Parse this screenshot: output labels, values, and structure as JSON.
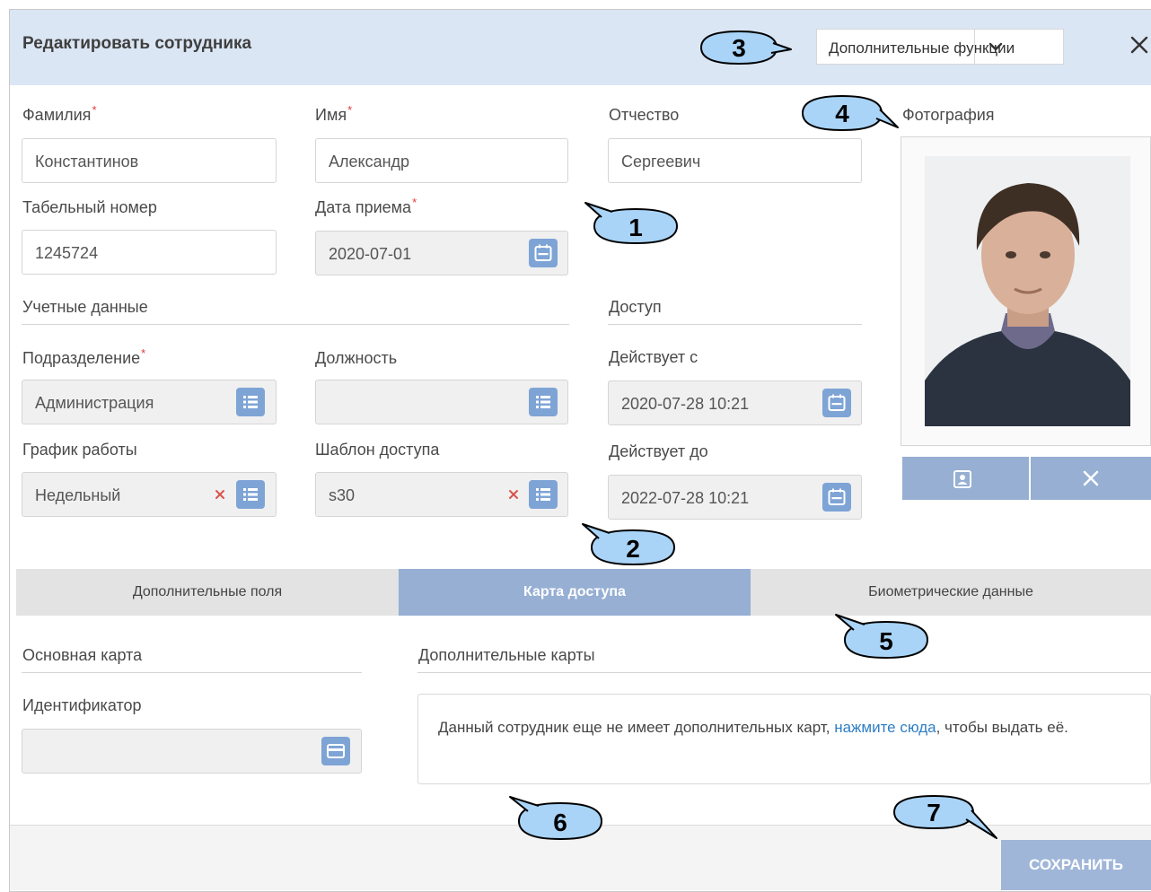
{
  "dialog": {
    "title": "Редактировать сотрудника",
    "functions_label": "Дополнительные функции"
  },
  "fields": {
    "last_name": {
      "label": "Фамилия",
      "required_mark": "*",
      "value": "Константинов"
    },
    "first_name": {
      "label": "Имя",
      "required_mark": "*",
      "value": "Александр"
    },
    "middle_name": {
      "label": "Отчество",
      "value": "Сергеевич"
    },
    "personnel_number": {
      "label": "Табельный номер",
      "value": "1245724"
    },
    "hire_date": {
      "label": "Дата приема",
      "required_mark": "*",
      "value": "2020-07-01"
    },
    "department": {
      "label": "Подразделение",
      "required_mark": "*",
      "value": "Администрация"
    },
    "position": {
      "label": "Должность",
      "value": ""
    },
    "schedule": {
      "label": "График работы",
      "value": "Недельный"
    },
    "access_template": {
      "label": "Шаблон доступа",
      "value": "s30"
    },
    "valid_from": {
      "label": "Действует с",
      "value": "2020-07-28 10:21"
    },
    "valid_to": {
      "label": "Действует до",
      "value": "2022-07-28 10:21"
    }
  },
  "sections": {
    "account": "Учетные данные",
    "access": "Доступ",
    "photo": "Фотография"
  },
  "tabs": [
    {
      "label": "Дополнительные поля",
      "active": false
    },
    {
      "label": "Карта доступа",
      "active": true
    },
    {
      "label": "Биометрические данные",
      "active": false
    }
  ],
  "card": {
    "main_title": "Основная карта",
    "identifier_label": "Идентификатор",
    "identifier_value": "",
    "extra_title": "Дополнительные карты",
    "notice_before": "Данный сотрудник еще не имеет дополнительных карт, ",
    "notice_link": "нажмите сюда",
    "notice_after": ", чтобы выдать её."
  },
  "footer": {
    "save_label": "СОХРАНИТЬ"
  },
  "callouts": [
    "1",
    "2",
    "3",
    "4",
    "5",
    "6",
    "7"
  ],
  "colors": {
    "header_bg": "#dbe6f4",
    "accent": "#7ea4d6",
    "tab_active": "#96afd3",
    "required": "#e23a3a",
    "link": "#2f7ec4",
    "callout_fill": "#a9d4f7"
  }
}
